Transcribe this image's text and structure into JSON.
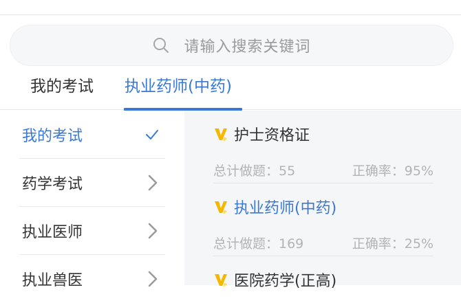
{
  "search": {
    "placeholder": "请输入搜索关键词"
  },
  "tabs": [
    {
      "label": "我的考试",
      "active": false
    },
    {
      "label": "执业药师(中药)",
      "active": true
    }
  ],
  "sidebar": {
    "items": [
      {
        "label": "我的考试",
        "active": true,
        "icon": "check-icon"
      },
      {
        "label": "药学考试",
        "active": false,
        "icon": "chevron-right-icon"
      },
      {
        "label": "执业医师",
        "active": false,
        "icon": "chevron-right-icon"
      },
      {
        "label": "执业兽医",
        "active": false,
        "icon": "chevron-right-icon"
      }
    ]
  },
  "exams": [
    {
      "title": "护士资格证",
      "total_label": "总计做题：55",
      "accuracy_label": "正确率：95%",
      "highlight": false,
      "badge": "vip-icon"
    },
    {
      "title": "执业药师(中药)",
      "total_label": "总计做题：169",
      "accuracy_label": "正确率：25%",
      "highlight": true,
      "badge": "vip-icon"
    },
    {
      "title": "医院药学(正高)",
      "highlight": false,
      "badge": "vip-icon"
    }
  ],
  "colors": {
    "accent": "#3a78d6",
    "vip_gold": "#f5b800",
    "muted": "#b3b3b3"
  }
}
